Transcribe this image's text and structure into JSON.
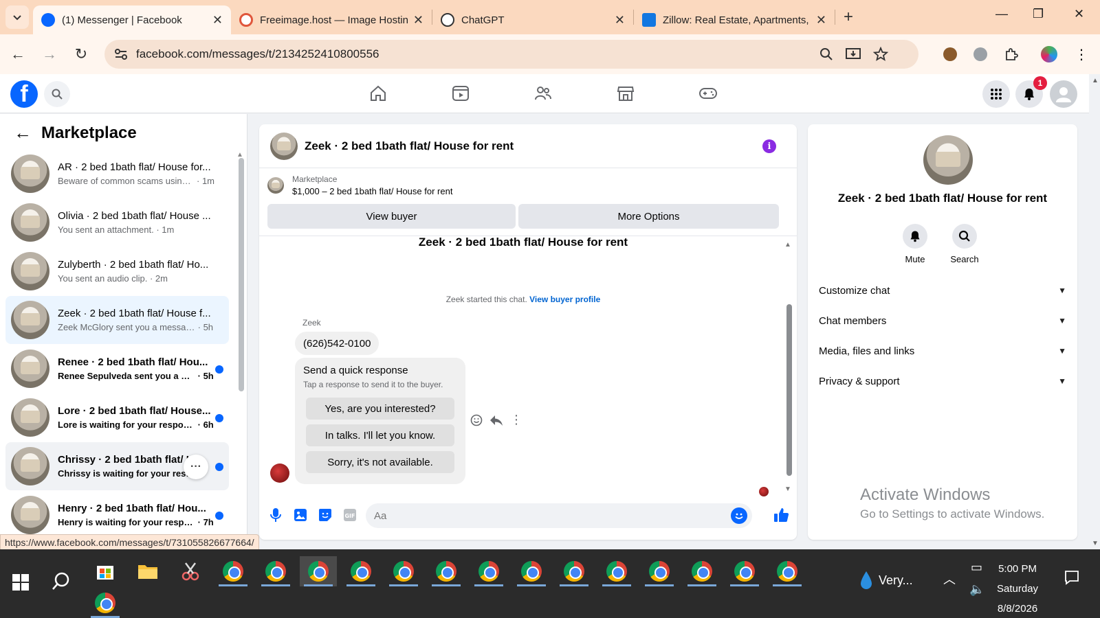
{
  "browser": {
    "tabs": [
      {
        "title": "(1) Messenger | Facebook",
        "active": true
      },
      {
        "title": "Freeimage.host — Image Hostin",
        "active": false
      },
      {
        "title": "ChatGPT",
        "active": false
      },
      {
        "title": "Zillow: Real Estate, Apartments,",
        "active": false
      }
    ],
    "url": "facebook.com/messages/t/2134252410800556",
    "status_link": "https://www.facebook.com/messages/t/731055826677664/"
  },
  "fb_nav": {
    "notifications_count": "1"
  },
  "sidebar": {
    "title": "Marketplace",
    "conversations": [
      {
        "name": "AR · 2 bed 1bath flat/ House for...",
        "snippet": "Beware of common scams using ...",
        "time": "· 1m",
        "unread": false
      },
      {
        "name": "Olivia · 2 bed 1bath flat/ House ...",
        "snippet": "You sent an attachment.",
        "time": "· 1m",
        "unread": false
      },
      {
        "name": "Zulyberth · 2 bed 1bath flat/ Ho...",
        "snippet": "You sent an audio clip.",
        "time": "· 2m",
        "unread": false
      },
      {
        "name": "Zeek · 2 bed 1bath flat/ House f...",
        "snippet": "Zeek McGlory sent you a message ...",
        "time": "· 5h",
        "unread": false
      },
      {
        "name": "Renee · 2 bed 1bath flat/ Hou...",
        "snippet": "Renee Sepulveda sent you a me...",
        "time": "· 5h",
        "unread": true
      },
      {
        "name": "Lore · 2 bed 1bath flat/ House...",
        "snippet": "Lore is waiting for your respon...",
        "time": "· 6h",
        "unread": true
      },
      {
        "name": "Chrissy · 2 bed 1bath flat/ H...",
        "snippet": "Chrissy is waiting for your resp...",
        "time": "",
        "unread": true
      },
      {
        "name": "Henry · 2 bed 1bath flat/ Hou...",
        "snippet": "Henry is waiting for your respo...",
        "time": "· 7h",
        "unread": true
      }
    ]
  },
  "chat": {
    "title": "Zeek · 2 bed 1bath flat/ House for rent",
    "marketplace_label": "Marketplace",
    "listing": "$1,000 – 2 bed 1bath flat/ House for rent",
    "view_buyer": "View buyer",
    "more_options": "More Options",
    "conversation_title": "Zeek · 2 bed 1bath flat/ House for rent",
    "started_text": "Zeek started this chat.",
    "view_buyer_profile": "View buyer profile",
    "sender": "Zeek",
    "message": "(626)542-0100",
    "quick_response_title": "Send a quick response",
    "quick_response_sub": "Tap a response to send it to the buyer.",
    "quick_responses": [
      "Yes, are you interested?",
      "In talks. I'll let you know.",
      "Sorry, it's not available."
    ],
    "composer_placeholder": "Aa"
  },
  "details": {
    "name": "Zeek · 2 bed 1bath flat/ House for rent",
    "mute": "Mute",
    "search": "Search",
    "sections": [
      "Customize chat",
      "Chat members",
      "Media, files and links",
      "Privacy & support"
    ],
    "watermark_title": "Activate Windows",
    "watermark_sub": "Go to Settings to activate Windows."
  },
  "taskbar": {
    "weather": "Very...",
    "time": "5:00 PM",
    "day": "Saturday",
    "date": "8/8/2026"
  }
}
